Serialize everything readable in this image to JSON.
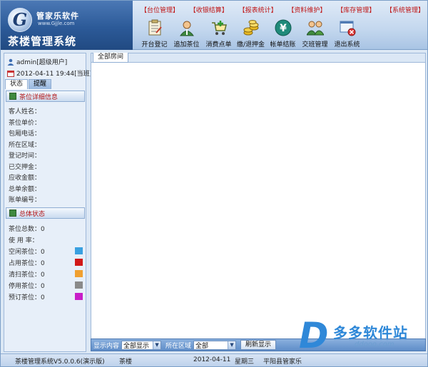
{
  "app": {
    "company": "管家乐软件",
    "company_url": "www.Gjjle.com",
    "title": "茶楼管理系统"
  },
  "top_menu": [
    {
      "label": "【台位管理】"
    },
    {
      "label": "【收银结算】"
    },
    {
      "label": "【报表统计】"
    },
    {
      "label": "【资料维护】"
    },
    {
      "label": "【库存管理】"
    },
    {
      "label": "【系统管理】"
    }
  ],
  "toolbar": [
    {
      "label": "开台登记",
      "icon": "clipboard-icon"
    },
    {
      "label": "追加茶位",
      "icon": "user-add-icon"
    },
    {
      "label": "消费点单",
      "icon": "cart-icon"
    },
    {
      "label": "缴/退押金",
      "icon": "coins-icon"
    },
    {
      "label": "帐单结账",
      "icon": "yen-icon"
    },
    {
      "label": "交班管理",
      "icon": "users-icon"
    },
    {
      "label": "退出系统",
      "icon": "exit-icon"
    }
  ],
  "session": {
    "user": "admin[超级用户]",
    "datetime": "2012-04-11 19:44[当班]"
  },
  "left_tabs": [
    {
      "label": "状态",
      "active": true
    },
    {
      "label": "提醒",
      "active": false
    }
  ],
  "detail_section": {
    "title": "茶位详细信息",
    "fields": [
      {
        "label": "客人姓名："
      },
      {
        "label": "茶位单价："
      },
      {
        "label": "包厢电话："
      },
      {
        "label": "所在区域："
      },
      {
        "label": "登记时间："
      },
      {
        "label": "已交押金："
      },
      {
        "label": "应收金额："
      },
      {
        "label": "总单余额："
      },
      {
        "label": "账单编号："
      }
    ]
  },
  "status_section": {
    "title": "总体状态",
    "items": [
      {
        "label": "茶位总数：0",
        "color": ""
      },
      {
        "label": "使 用 率：",
        "color": ""
      },
      {
        "label": "空闲茶位：0",
        "color": "#3aa0e0"
      },
      {
        "label": "占用茶位：0",
        "color": "#d11818"
      },
      {
        "label": "清扫茶位：0",
        "color": "#f0a030"
      },
      {
        "label": "停用茶位：0",
        "color": "#8a8a8a"
      },
      {
        "label": "预订茶位：0",
        "color": "#c81ec8"
      }
    ]
  },
  "main": {
    "tab": "全部房间"
  },
  "filter": {
    "display_label": "显示内容",
    "display_value": "全部显示",
    "area_label": "所在区域",
    "area_value": "全部",
    "refresh_label": "刷新显示"
  },
  "statusbar": {
    "version": "茶楼管理系统V5.0.0.6(演示版)",
    "module": "茶楼",
    "date": "2012-04-11",
    "weekday": "星期三",
    "company": "平阳县管家乐"
  },
  "watermark": {
    "letter": "D",
    "text": "多多软件站",
    "url": "ddooo.com"
  }
}
